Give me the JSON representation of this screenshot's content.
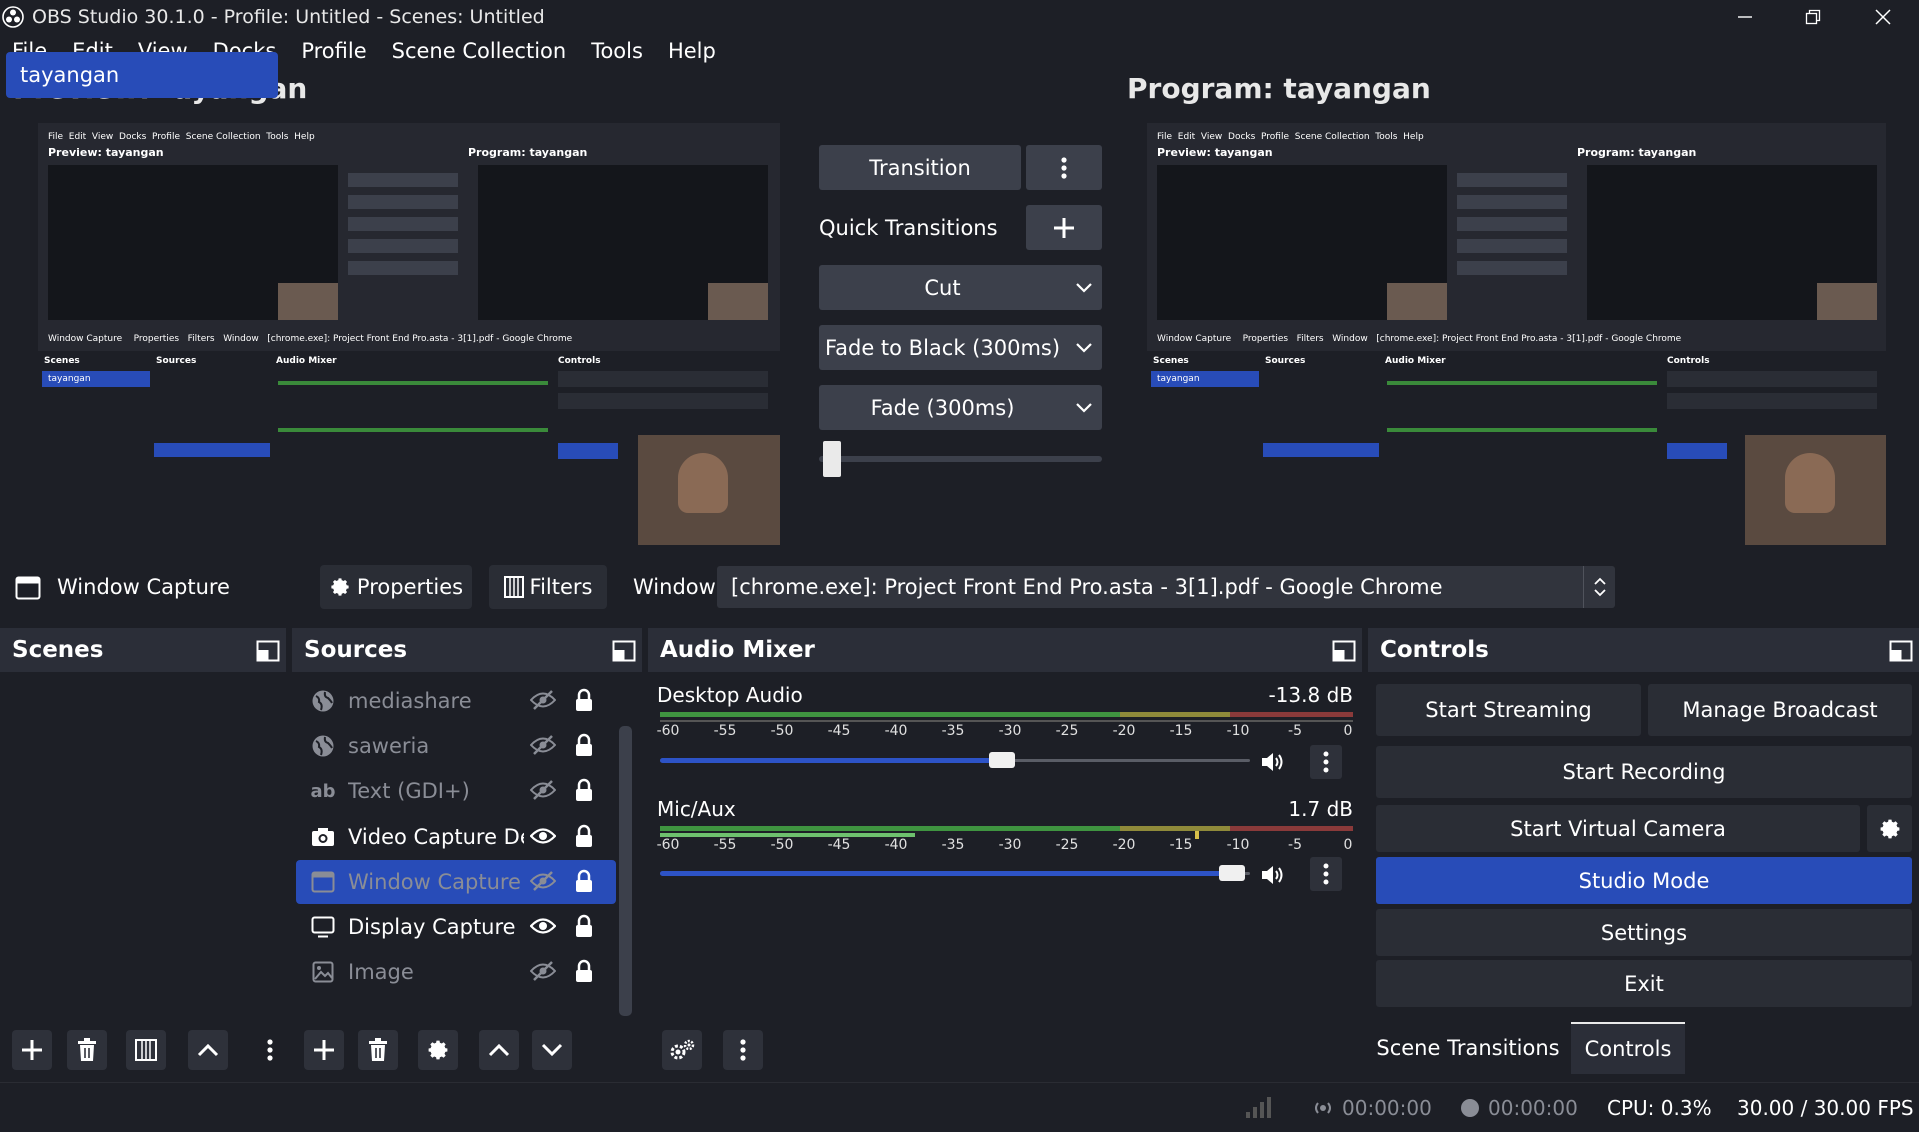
{
  "window": {
    "title": "OBS Studio 30.1.0 - Profile: Untitled - Scenes: Untitled"
  },
  "menu": [
    "File",
    "Edit",
    "View",
    "Docks",
    "Profile",
    "Scene Collection",
    "Tools",
    "Help"
  ],
  "preview": {
    "title": "Preview: tayangan"
  },
  "program": {
    "title": "Program: tayangan"
  },
  "transitions": {
    "transition_label": "Transition",
    "quick_label": "Quick Transitions",
    "cut": "Cut",
    "fade_black": "Fade to Black (300ms)",
    "fade": "Fade (300ms)"
  },
  "context": {
    "source_name": "Window Capture",
    "properties": "Properties",
    "filters": "Filters",
    "window_label": "Window",
    "window_value": "[chrome.exe]: Project Front End Pro.asta - 3[1].pdf - Google Chrome"
  },
  "scenes": {
    "title": "Scenes",
    "items": [
      "tayangan"
    ]
  },
  "sources": {
    "title": "Sources",
    "items": [
      {
        "name": "mediashare",
        "icon": "globe-icon",
        "visible": false
      },
      {
        "name": "saweria",
        "icon": "globe-icon",
        "visible": false
      },
      {
        "name": "Text (GDI+)",
        "icon": "text-icon",
        "visible": false
      },
      {
        "name": "Video Capture Device",
        "icon": "camera-icon",
        "visible": true
      },
      {
        "name": "Window Capture",
        "icon": "window-icon",
        "visible": false
      },
      {
        "name": "Display Capture",
        "icon": "monitor-icon",
        "visible": true
      },
      {
        "name": "Image",
        "icon": "image-icon",
        "visible": false
      }
    ]
  },
  "mixer": {
    "title": "Audio Mixer",
    "channels": [
      {
        "name": "Desktop Audio",
        "db": "-13.8 dB",
        "volume": 0.58
      },
      {
        "name": "Mic/Aux",
        "db": "1.7 dB",
        "volume": 0.97
      }
    ],
    "scale": [
      "-60",
      "-55",
      "-50",
      "-45",
      "-40",
      "-35",
      "-30",
      "-25",
      "-20",
      "-15",
      "-10",
      "-5",
      "0"
    ]
  },
  "controls": {
    "title": "Controls",
    "start_streaming": "Start Streaming",
    "manage_broadcast": "Manage Broadcast",
    "start_recording": "Start Recording",
    "start_virtual_camera": "Start Virtual Camera",
    "studio_mode": "Studio Mode",
    "settings": "Settings",
    "exit": "Exit"
  },
  "tabs": {
    "scene_transitions": "Scene Transitions",
    "controls": "Controls"
  },
  "status": {
    "stream_time": "00:00:00",
    "rec_time": "00:00:00",
    "cpu": "CPU: 0.3%",
    "fps": "30.00 / 30.00 FPS"
  },
  "colors": {
    "accent": "#284cb8",
    "background": "#1d1f26",
    "panel": "#262830",
    "button": "#3c404b"
  }
}
